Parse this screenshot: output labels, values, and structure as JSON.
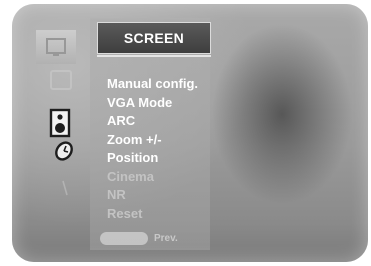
{
  "menu": {
    "title": "SCREEN",
    "items": [
      {
        "label": "Manual config.",
        "state": "normal"
      },
      {
        "label": "VGA Mode",
        "state": "normal"
      },
      {
        "label": "ARC",
        "state": "normal"
      },
      {
        "label": "Zoom +/-",
        "state": "normal"
      },
      {
        "label": "Position",
        "state": "normal"
      },
      {
        "label": "Cinema",
        "state": "disabled"
      },
      {
        "label": "NR",
        "state": "disabled"
      },
      {
        "label": "Reset",
        "state": "disabled"
      }
    ]
  },
  "nav": {
    "prev_label": "Prev."
  },
  "sidebar_icons": [
    "picture-tile-icon",
    "dim-square-icon",
    "speaker-icon",
    "clock-icon",
    "faint-icon"
  ],
  "colors": {
    "title_bg": "#4a4a4a",
    "text_active": "#ffffff",
    "text_disabled": "#c3c3c3"
  }
}
